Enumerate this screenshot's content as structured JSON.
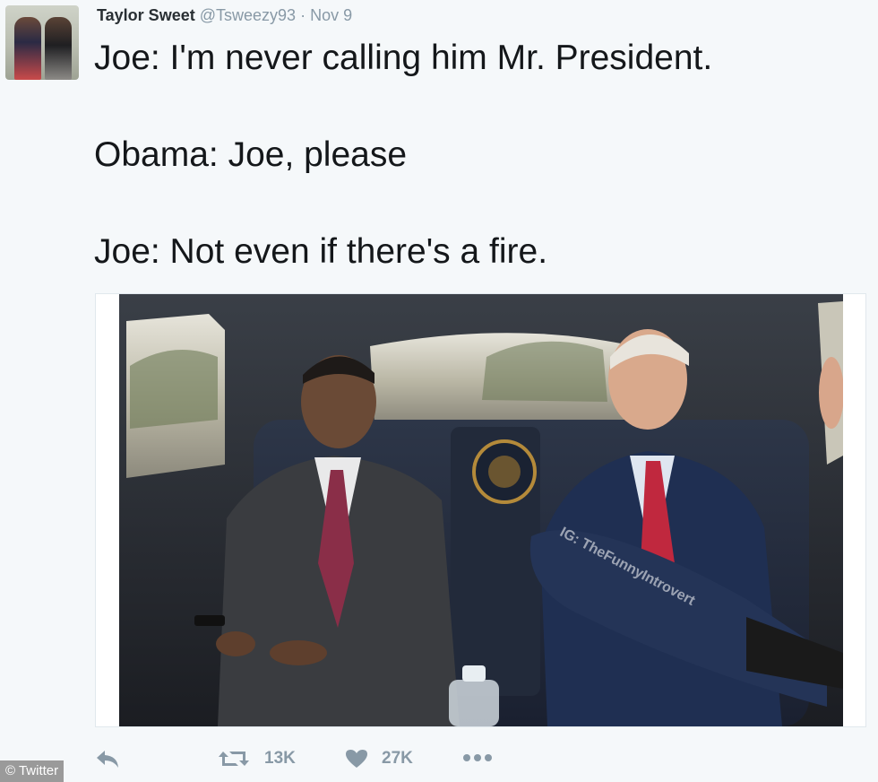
{
  "tweet": {
    "display_name": "Taylor Sweet",
    "handle": "@Tsweezy93",
    "separator": "·",
    "date": "Nov 9",
    "lines": [
      "Joe: I'm never calling him Mr. President.",
      "Obama: Joe, please",
      "Joe: Not even if there's a fire."
    ]
  },
  "media": {
    "watermark": "IG: TheFunnyIntrovert"
  },
  "actions": {
    "retweet_count": "13K",
    "like_count": "27K"
  },
  "credit": {
    "text": "© Twitter"
  },
  "icons": [
    "reply-icon",
    "retweet-icon",
    "heart-icon",
    "more-icon"
  ],
  "colors": {
    "background": "#f5f8fa",
    "text": "#14171a",
    "muted": "#8899a6"
  }
}
